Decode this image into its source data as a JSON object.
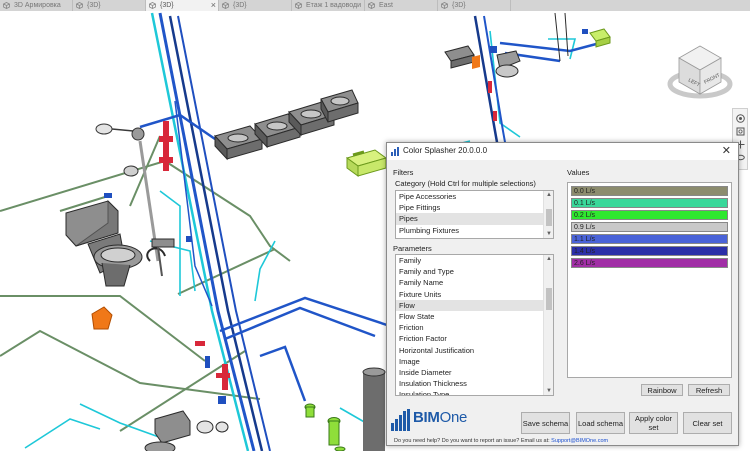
{
  "tabs": [
    {
      "label": "3D Армировка",
      "active": false,
      "closable": false
    },
    {
      "label": "{3D}",
      "active": false,
      "closable": false
    },
    {
      "label": "{3D}",
      "active": true,
      "closable": true
    },
    {
      "label": "{3D}",
      "active": false,
      "closable": false
    },
    {
      "label": "Етаж 1 вадоводи",
      "active": false,
      "closable": false
    },
    {
      "label": "East",
      "active": false,
      "closable": false
    },
    {
      "label": "{3D}",
      "active": false,
      "closable": false
    }
  ],
  "viewcube": {
    "left": "LEFT",
    "front": "FRONT"
  },
  "dialog": {
    "title": "Color Splasher 20.0.0.0",
    "close": "✕",
    "filters_label": "Filters",
    "category_label": "Category (Hold Ctrl for multiple selections)",
    "categories": [
      "Pipe Accessories",
      "Pipe Fittings",
      "Pipes",
      "Plumbing Fixtures"
    ],
    "selected_category": "Pipes",
    "parameters_label": "Parameters",
    "parameters": [
      "Family",
      "Family and Type",
      "Family Name",
      "Fixture Units",
      "Flow",
      "Flow State",
      "Friction",
      "Friction Factor",
      "Horizontal Justification",
      "Image",
      "Inside Diameter",
      "Insulation Thickness",
      "Insulation Type"
    ],
    "selected_parameter": "Flow",
    "values_label": "Values",
    "values": [
      {
        "label": "0.0 L/s",
        "color": "#8c8c6e"
      },
      {
        "label": "0.1 L/s",
        "color": "#39d89a"
      },
      {
        "label": "0.2 L/s",
        "color": "#2fe82f"
      },
      {
        "label": "0.9 L/s",
        "color": "#c8c8c8"
      },
      {
        "label": "1.1 L/s",
        "color": "#4a63d8"
      },
      {
        "label": "1.4 L/s",
        "color": "#2b2fa8"
      },
      {
        "label": "2.6 L/s",
        "color": "#a12ea6"
      }
    ],
    "rainbow": "Rainbow",
    "refresh": "Refresh",
    "save_schema": "Save schema",
    "load_schema": "Load schema",
    "apply_color_set": "Apply color set",
    "clear_set": "Clear set",
    "logo_text_bim": "BIM",
    "logo_text_one": "One",
    "footer_text": "Do you need help? Do you want to report an issue? Email us at:",
    "footer_email": "Support@BIMOne.com"
  },
  "colors": {
    "pipe_blue": "#1f4fbf",
    "pipe_dark_blue": "#163a8c",
    "pipe_cyan": "#1ec8d8",
    "pipe_red": "#d8283a",
    "pipe_green": "#6a8f66",
    "fixture_lime": "#c8ee6a",
    "orange": "#f07818"
  }
}
